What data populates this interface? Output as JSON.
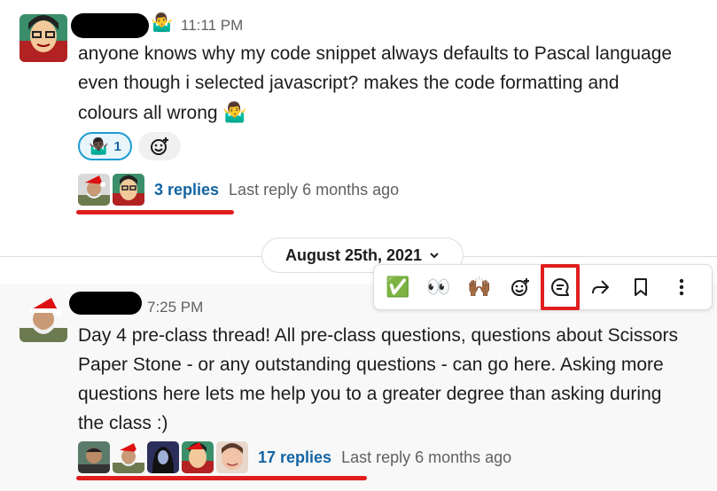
{
  "message1": {
    "time": "11:11 PM",
    "status_emoji": "🤷‍♂️",
    "lines": [
      "anyone knows why my code snippet always defaults to Pascal language",
      "even though i selected javascript? makes the code formatting and",
      "colours all wrong"
    ],
    "inline_emoji": "🤷‍♂️",
    "reaction": {
      "emoji": "🤷🏿‍♂️",
      "count": "1"
    },
    "thread": {
      "replies": "3 replies",
      "last_reply": "Last reply 6 months ago"
    }
  },
  "date_divider": {
    "label": "August 25th, 2021"
  },
  "toolbar": {
    "quick_reactions": [
      "✅",
      "👀",
      "🙌🏾"
    ]
  },
  "message2": {
    "time": "7:25 PM",
    "lines": [
      "Day 4 pre-class thread! All pre-class questions, questions about Scissors",
      "Paper Stone - or any outstanding questions - can go here. Asking  more",
      "questions here lets me help you to a greater degree than asking during",
      "the class :)"
    ],
    "thread": {
      "replies": "17 replies",
      "last_reply": "Last reply 6 months ago"
    }
  },
  "colors": {
    "link": "#1264a3",
    "highlight": "#e01e1e",
    "reaction_border": "#1d9bd1",
    "reaction_bg": "#e8f5fa"
  }
}
